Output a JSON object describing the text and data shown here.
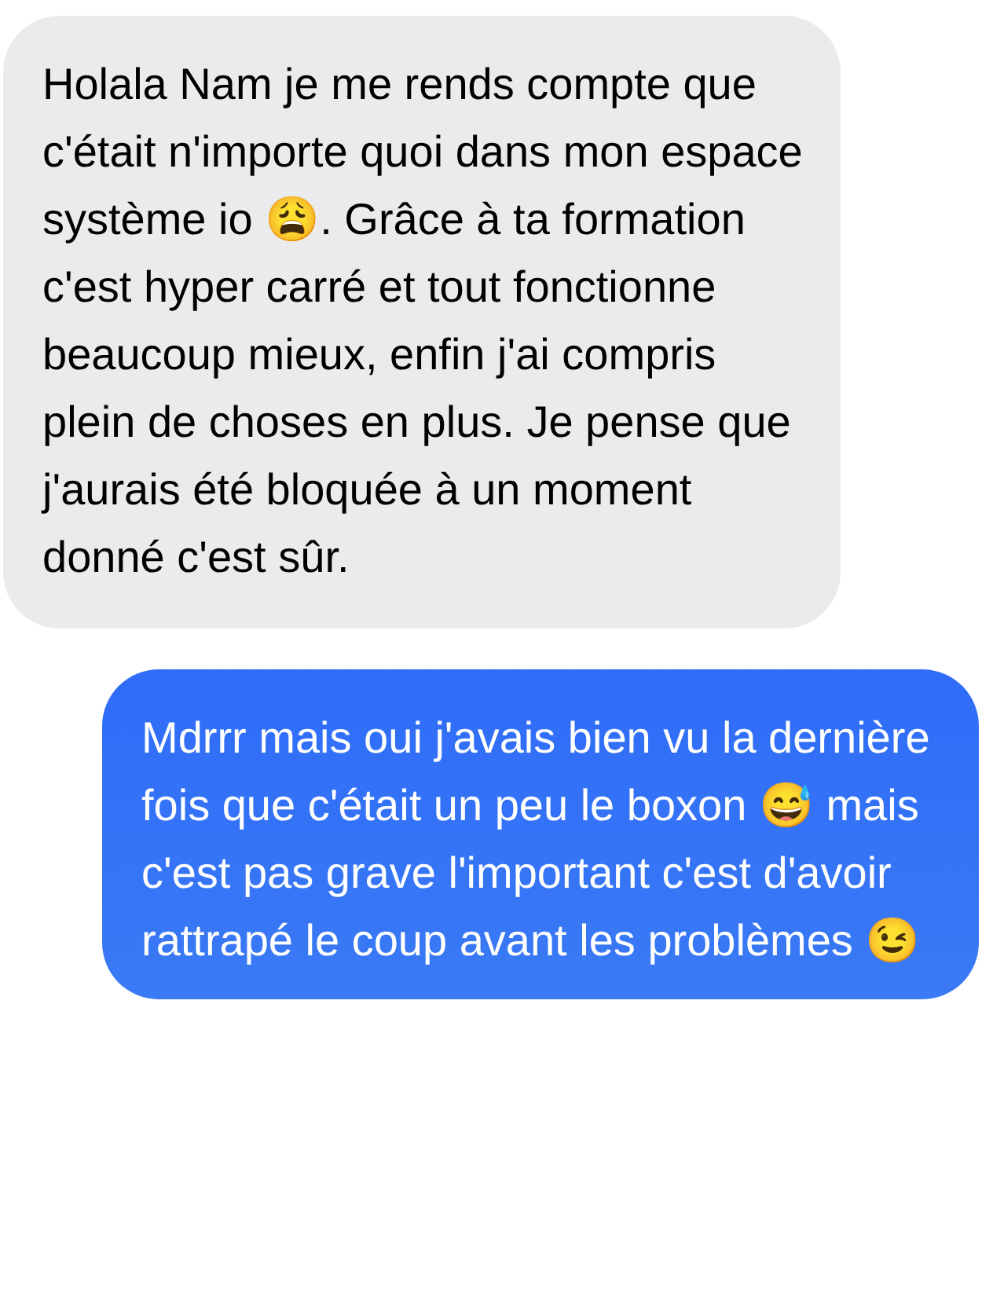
{
  "messages": [
    {
      "kind": "received",
      "text": "Holala Nam je me rends compte que c'était n'importe quoi dans mon espace système io 😩. Grâce à ta formation c'est hyper carré et tout fonctionne beaucoup mieux, enfin j'ai compris plein de choses en plus. Je pense que j'aurais été bloquée à un moment donné c'est sûr."
    },
    {
      "kind": "sent",
      "text": "Mdrrr mais oui j'avais bien vu la dernière fois que c'était un peu le boxon 😅 mais c'est pas grave l'important c'est d'avoir rattrapé le coup avant les problèmes 😉"
    }
  ]
}
